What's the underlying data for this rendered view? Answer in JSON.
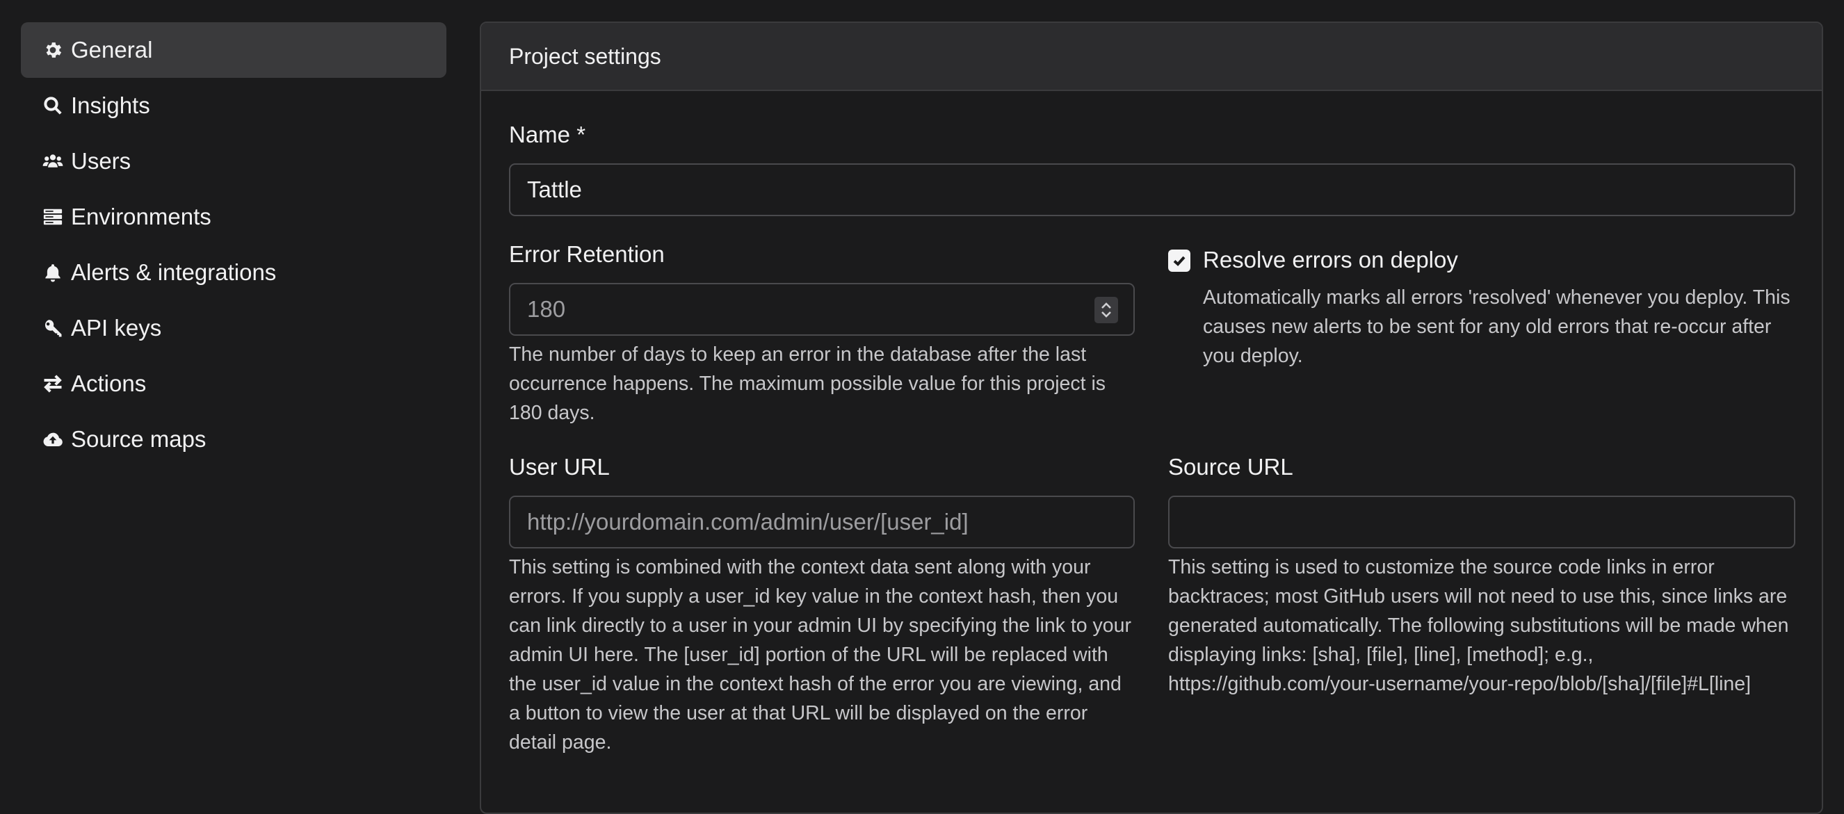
{
  "sidebar": {
    "items": [
      {
        "label": "General",
        "icon": "gear-icon",
        "active": true
      },
      {
        "label": "Insights",
        "icon": "search-icon"
      },
      {
        "label": "Users",
        "icon": "users-icon"
      },
      {
        "label": "Environments",
        "icon": "server-icon"
      },
      {
        "label": "Alerts & integrations",
        "icon": "bell-icon"
      },
      {
        "label": "API keys",
        "icon": "key-icon"
      },
      {
        "label": "Actions",
        "icon": "arrows-exchange-icon"
      },
      {
        "label": "Source maps",
        "icon": "cloud-upload-icon"
      }
    ]
  },
  "card": {
    "title": "Project settings"
  },
  "form": {
    "name": {
      "label": "Name *",
      "value": "Tattle"
    },
    "error_retention": {
      "label": "Error Retention",
      "placeholder": "180",
      "help": "The number of days to keep an error in the database after the last occurrence happens. The maximum possible value for this project is 180 days."
    },
    "resolve_on_deploy": {
      "label": "Resolve errors on deploy",
      "checked": true,
      "help": "Automatically marks all errors 'resolved' whenever you deploy. This causes new alerts to be sent for any old errors that re-occur after you deploy."
    },
    "user_url": {
      "label": "User URL",
      "placeholder": "http://yourdomain.com/admin/user/[user_id]",
      "help": "This setting is combined with the context data sent along with your errors. If you supply a user_id key value in the context hash, then you can link directly to a user in your admin UI by specifying the link to your admin UI here. The [user_id] portion of the URL will be replaced with the user_id value in the context hash of the error you are viewing, and a button to view the user at that URL will be displayed on the error detail page."
    },
    "source_url": {
      "label": "Source URL",
      "value": "",
      "help": "This setting is used to customize the source code links in error backtraces; most GitHub users will not need to use this, since links are generated automatically. The following substitutions will be made when displaying links: [sha], [file], [line], [method]; e.g., https://github.com/your-username/your-repo/blob/[sha]/[file]#L[line]"
    }
  },
  "colors": {
    "background": "#1b1b1c",
    "card_header": "#2c2c2e",
    "active_nav": "#3a3a3c",
    "border": "#3b3b3d",
    "text": "#f1f1f2",
    "muted_text": "#c7c7ca",
    "placeholder": "#9d9da0"
  }
}
